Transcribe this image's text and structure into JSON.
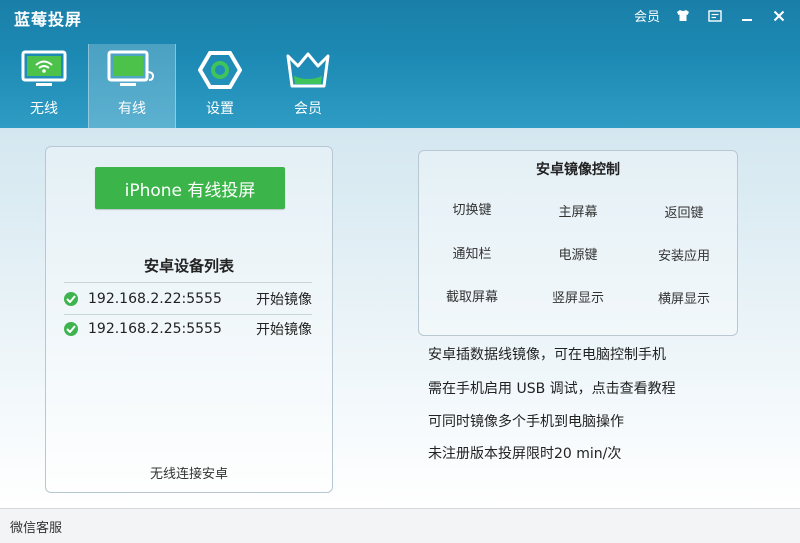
{
  "app": {
    "title": "蓝莓投屏"
  },
  "window_controls": {
    "vip_label": "会员"
  },
  "nav": [
    {
      "label": "无线",
      "icon": "wifi-monitor-icon"
    },
    {
      "label": "有线",
      "icon": "wired-monitor-icon",
      "active": true
    },
    {
      "label": "设置",
      "icon": "hexagon-settings-icon"
    },
    {
      "label": "会员",
      "icon": "crown-icon"
    }
  ],
  "left_panel": {
    "iphone_button": "iPhone 有线投屏",
    "list_title": "安卓设备列表",
    "devices": [
      {
        "ip": "192.168.2.22:5555",
        "action": "开始镜像"
      },
      {
        "ip": "192.168.2.25:5555",
        "action": "开始镜像"
      }
    ],
    "wireless_link": "无线连接安卓"
  },
  "right_panel": {
    "title": "安卓镜像控制",
    "buttons": [
      "切换键",
      "主屏幕",
      "返回键",
      "通知栏",
      "电源键",
      "安装应用",
      "截取屏幕",
      "竖屏显示",
      "横屏显示"
    ]
  },
  "info_lines": [
    "安卓插数据线镜像，可在电脑控制手机",
    "需在手机启用 USB 调试，点击查看教程",
    "可同时镜像多个手机到电脑操作",
    "未注册版本投屏限时20 min/次"
  ],
  "status": {
    "wechat_service": "微信客服"
  },
  "colors": {
    "header": "#1c8ab4",
    "green_button": "#3bb54a",
    "check": "#3fb34f"
  }
}
